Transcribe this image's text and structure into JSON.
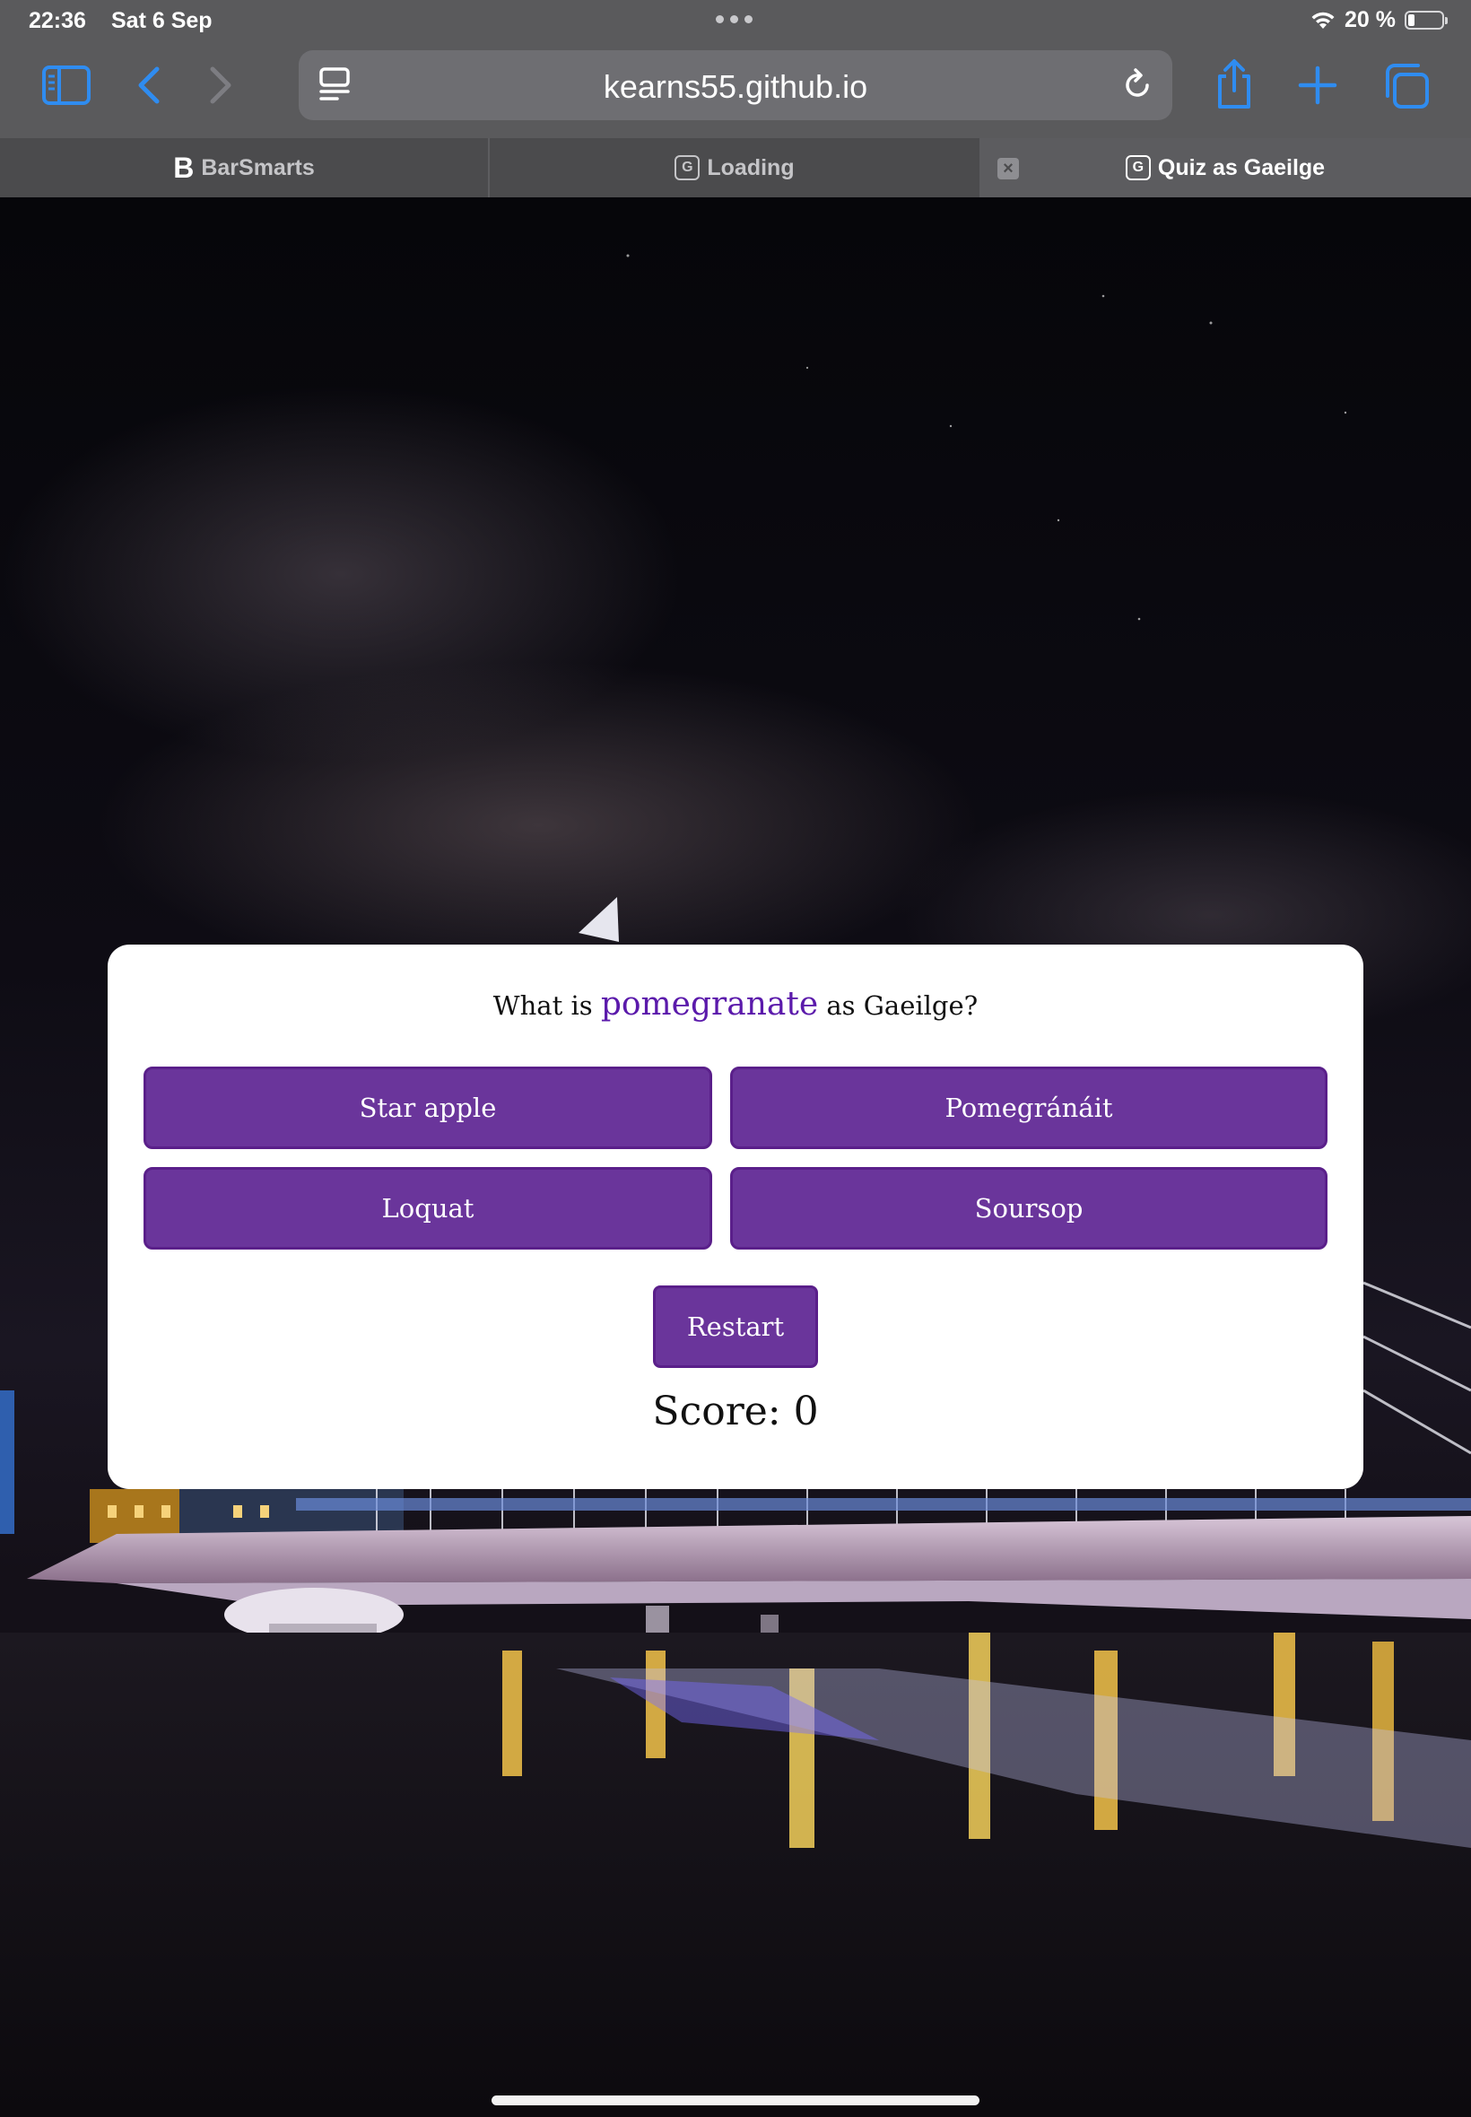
{
  "status_bar": {
    "time": "22:36",
    "date": "Sat 6 Sep",
    "battery": "20 %",
    "battery_level": 0.2
  },
  "browser": {
    "url": "kearns55.github.io",
    "accent_color": "#2f8cf0"
  },
  "tabs": [
    {
      "label": "BarSmarts",
      "favicon": "B",
      "active": false
    },
    {
      "label": "Loading",
      "favicon": "G",
      "active": false
    },
    {
      "label": "Quiz as Gaeilge",
      "favicon": "G",
      "active": true
    }
  ],
  "quiz": {
    "question_prefix": "What is",
    "term": "pomegranate",
    "question_suffix": "as Gaeilge?",
    "answers": [
      "Star apple",
      "Pomegránáit",
      "Loquat",
      "Soursop"
    ],
    "restart_label": "Restart",
    "score_text": "Score: 0",
    "button_color": "#6a359b",
    "term_color": "#5b1aab"
  }
}
